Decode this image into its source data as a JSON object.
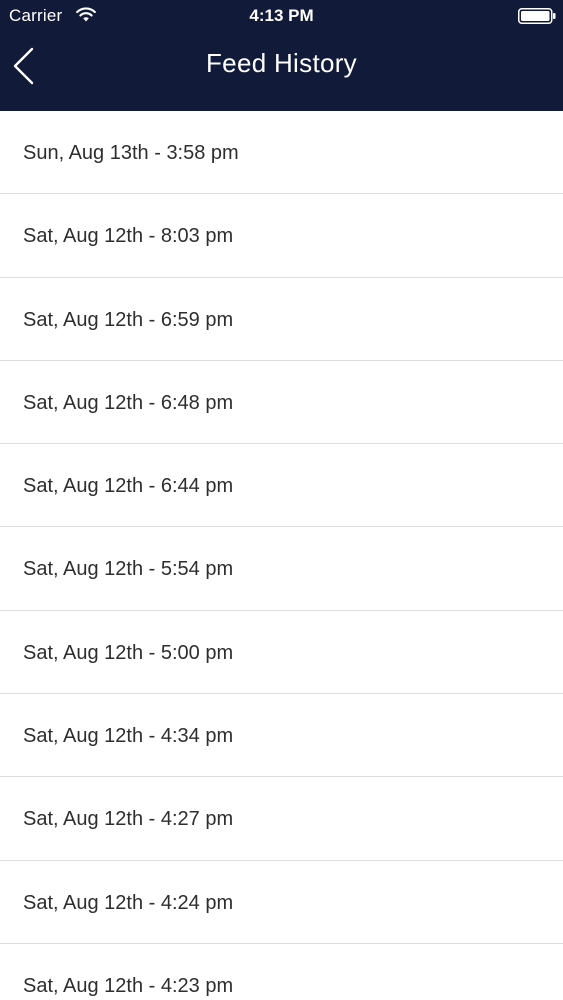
{
  "status_bar": {
    "carrier": "Carrier",
    "time": "4:13 PM",
    "wifi_icon": "wifi-icon",
    "battery_icon": "battery-icon"
  },
  "nav": {
    "title": "Feed History",
    "back_icon": "chevron-left-icon",
    "background_color": "#121a3a"
  },
  "feed_history": [
    "Sun, Aug 13th - 3:58 pm",
    "Sat, Aug 12th - 8:03 pm",
    "Sat, Aug 12th - 6:59 pm",
    "Sat, Aug 12th - 6:48 pm",
    "Sat, Aug 12th - 6:44 pm",
    "Sat, Aug 12th - 5:54 pm",
    "Sat, Aug 12th - 5:00 pm",
    "Sat, Aug 12th - 4:34 pm",
    "Sat, Aug 12th - 4:27 pm",
    "Sat, Aug 12th - 4:24 pm",
    "Sat, Aug 12th - 4:23 pm"
  ]
}
